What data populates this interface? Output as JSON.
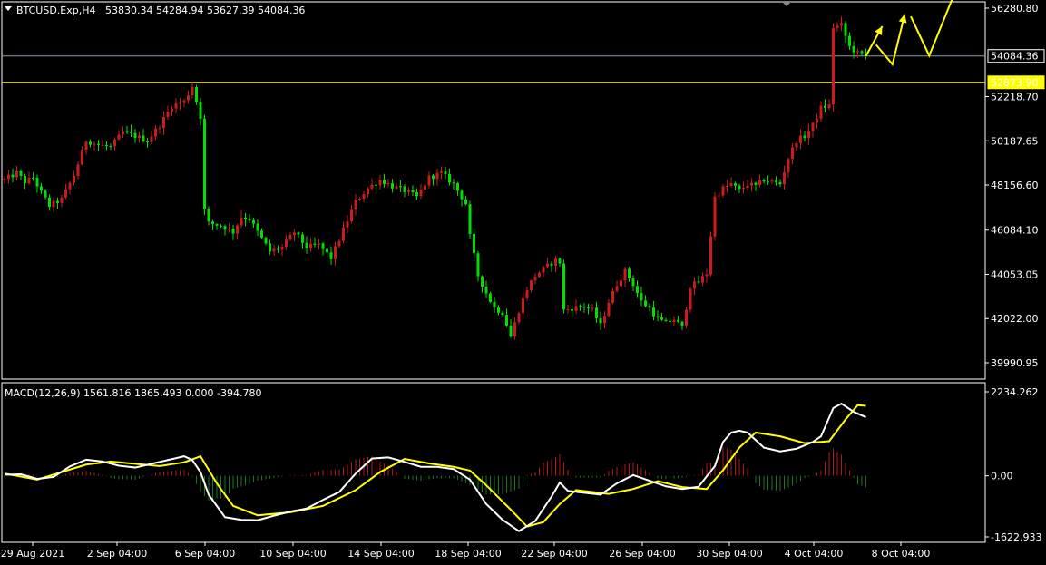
{
  "colors": {
    "background": "#000000",
    "frame": "#ffffff",
    "candle_up": "#cc1b1b",
    "candle_down": "#00e000",
    "level_line": "#ffff00",
    "price_line": "#8a9aa8",
    "macd_line": "#ffffff",
    "signal_line": "#ffff00",
    "hist_pos": "#b01818",
    "hist_neg": "#1a7a1a",
    "annotation": "#ffff00"
  },
  "header": {
    "menu_icon": "triangle-down-icon",
    "symbol": "BTCUSD.Exp,H4",
    "ohlc": "53830.34 54284.94 53627.39 54084.36"
  },
  "price_panel": {
    "y_ticks": [
      "56280.80",
      "52218.70",
      "50187.65",
      "48156.60",
      "46084.10",
      "44053.05",
      "42022.00",
      "39990.95"
    ],
    "current_price_label": "54084.36",
    "level_label": "52873.90"
  },
  "macd_panel": {
    "title": "MACD(12,26,9) 1561.816 1865.493 0.000 -394.780",
    "y_ticks": [
      "2234.262",
      "0.00",
      "-1622.933"
    ]
  },
  "time_axis": {
    "labels": [
      "29 Aug 2021",
      "2 Sep 04:00",
      "6 Sep 04:00",
      "10 Sep 04:00",
      "14 Sep 04:00",
      "18 Sep 04:00",
      "22 Sep 04:00",
      "26 Sep 04:00",
      "30 Sep 04:00",
      "4 Oct 04:00",
      "8 Oct 04:00"
    ]
  },
  "chart_data": {
    "type": "candlestick",
    "price_axis_range": [
      39990.95,
      56280.8
    ],
    "horizontal_levels": [
      52873.9,
      54084.36
    ],
    "close_path_anchors": [
      [
        0,
        48400
      ],
      [
        3,
        48700
      ],
      [
        5,
        48300
      ],
      [
        7,
        48500
      ],
      [
        9,
        47800
      ],
      [
        11,
        47200
      ],
      [
        14,
        47500
      ],
      [
        17,
        48600
      ],
      [
        20,
        50200
      ],
      [
        23,
        50000
      ],
      [
        26,
        49900
      ],
      [
        29,
        50600
      ],
      [
        32,
        50400
      ],
      [
        35,
        50200
      ],
      [
        38,
        50900
      ],
      [
        41,
        51800
      ],
      [
        44,
        52000
      ],
      [
        46,
        52700
      ],
      [
        47,
        52000
      ],
      [
        48,
        51300
      ],
      [
        49,
        47000
      ],
      [
        50,
        46400
      ],
      [
        53,
        46300
      ],
      [
        56,
        46000
      ],
      [
        58,
        46700
      ],
      [
        60,
        46600
      ],
      [
        62,
        46000
      ],
      [
        65,
        45100
      ],
      [
        68,
        45300
      ],
      [
        71,
        46000
      ],
      [
        74,
        45300
      ],
      [
        77,
        45400
      ],
      [
        80,
        44800
      ],
      [
        83,
        46100
      ],
      [
        86,
        47400
      ],
      [
        89,
        48000
      ],
      [
        92,
        48400
      ],
      [
        95,
        48100
      ],
      [
        98,
        47900
      ],
      [
        101,
        47600
      ],
      [
        104,
        48500
      ],
      [
        107,
        48700
      ],
      [
        110,
        48200
      ],
      [
        113,
        47300
      ],
      [
        114,
        45800
      ],
      [
        116,
        44000
      ],
      [
        118,
        43200
      ],
      [
        120,
        42500
      ],
      [
        122,
        42300
      ],
      [
        124,
        41200
      ],
      [
        126,
        42400
      ],
      [
        128,
        43400
      ],
      [
        130,
        44000
      ],
      [
        132,
        44300
      ],
      [
        135,
        44700
      ],
      [
        136,
        44600
      ],
      [
        137,
        42400
      ],
      [
        139,
        42500
      ],
      [
        142,
        42600
      ],
      [
        144,
        42400
      ],
      [
        146,
        41700
      ],
      [
        148,
        42800
      ],
      [
        150,
        43600
      ],
      [
        152,
        44200
      ],
      [
        154,
        43600
      ],
      [
        156,
        42800
      ],
      [
        158,
        42500
      ],
      [
        160,
        42000
      ],
      [
        162,
        41800
      ],
      [
        164,
        42000
      ],
      [
        166,
        41600
      ],
      [
        168,
        43500
      ],
      [
        170,
        43700
      ],
      [
        172,
        44100
      ],
      [
        174,
        47600
      ],
      [
        176,
        48000
      ],
      [
        178,
        48200
      ],
      [
        180,
        47900
      ],
      [
        182,
        48200
      ],
      [
        184,
        48100
      ],
      [
        186,
        48400
      ],
      [
        188,
        48300
      ],
      [
        190,
        48200
      ],
      [
        192,
        49400
      ],
      [
        194,
        50200
      ],
      [
        196,
        50400
      ],
      [
        198,
        50900
      ],
      [
        200,
        51700
      ],
      [
        202,
        51800
      ],
      [
        203,
        55400
      ],
      [
        205,
        55500
      ],
      [
        207,
        54500
      ],
      [
        209,
        54200
      ],
      [
        211,
        54100
      ]
    ],
    "macd_range": [
      -1622.933,
      2234.262
    ],
    "macd_anchors": [
      [
        0,
        30
      ],
      [
        4,
        40
      ],
      [
        8,
        -80
      ],
      [
        12,
        -30
      ],
      [
        16,
        250
      ],
      [
        20,
        430
      ],
      [
        24,
        380
      ],
      [
        28,
        270
      ],
      [
        32,
        220
      ],
      [
        36,
        320
      ],
      [
        40,
        420
      ],
      [
        44,
        520
      ],
      [
        46,
        420
      ],
      [
        48,
        100
      ],
      [
        50,
        -500
      ],
      [
        54,
        -1100
      ],
      [
        58,
        -1170
      ],
      [
        62,
        -1180
      ],
      [
        66,
        -1060
      ],
      [
        70,
        -950
      ],
      [
        74,
        -870
      ],
      [
        78,
        -640
      ],
      [
        82,
        -430
      ],
      [
        86,
        60
      ],
      [
        90,
        460
      ],
      [
        94,
        490
      ],
      [
        98,
        370
      ],
      [
        102,
        240
      ],
      [
        106,
        240
      ],
      [
        110,
        180
      ],
      [
        114,
        -100
      ],
      [
        118,
        -750
      ],
      [
        122,
        -1170
      ],
      [
        126,
        -1470
      ],
      [
        130,
        -1200
      ],
      [
        134,
        -550
      ],
      [
        136,
        -180
      ],
      [
        138,
        -400
      ],
      [
        142,
        -450
      ],
      [
        146,
        -500
      ],
      [
        150,
        -200
      ],
      [
        154,
        20
      ],
      [
        158,
        -130
      ],
      [
        162,
        -280
      ],
      [
        166,
        -350
      ],
      [
        170,
        -290
      ],
      [
        174,
        260
      ],
      [
        176,
        900
      ],
      [
        178,
        1150
      ],
      [
        180,
        1200
      ],
      [
        182,
        1150
      ],
      [
        186,
        750
      ],
      [
        190,
        650
      ],
      [
        194,
        720
      ],
      [
        198,
        900
      ],
      [
        200,
        1050
      ],
      [
        203,
        1800
      ],
      [
        205,
        1920
      ],
      [
        208,
        1700
      ],
      [
        211,
        1560
      ]
    ],
    "signal_anchors": [
      [
        0,
        60
      ],
      [
        8,
        -100
      ],
      [
        14,
        100
      ],
      [
        20,
        300
      ],
      [
        26,
        380
      ],
      [
        32,
        320
      ],
      [
        38,
        260
      ],
      [
        44,
        360
      ],
      [
        48,
        520
      ],
      [
        52,
        -200
      ],
      [
        56,
        -800
      ],
      [
        62,
        -1050
      ],
      [
        70,
        -970
      ],
      [
        78,
        -800
      ],
      [
        86,
        -380
      ],
      [
        92,
        100
      ],
      [
        98,
        450
      ],
      [
        104,
        330
      ],
      [
        110,
        240
      ],
      [
        114,
        140
      ],
      [
        118,
        -250
      ],
      [
        124,
        -900
      ],
      [
        128,
        -1350
      ],
      [
        132,
        -1230
      ],
      [
        136,
        -750
      ],
      [
        140,
        -380
      ],
      [
        148,
        -480
      ],
      [
        154,
        -350
      ],
      [
        160,
        -140
      ],
      [
        166,
        -300
      ],
      [
        172,
        -350
      ],
      [
        176,
        150
      ],
      [
        180,
        750
      ],
      [
        184,
        1150
      ],
      [
        190,
        1050
      ],
      [
        196,
        870
      ],
      [
        202,
        920
      ],
      [
        206,
        1500
      ],
      [
        209,
        1880
      ],
      [
        211,
        1860
      ]
    ],
    "annotation_arrows": [
      [
        [
          211,
          54084.36
        ],
        [
          215,
          55450
        ]
      ],
      [
        [
          213.5,
          54600
        ],
        [
          217.5,
          53700
        ],
        [
          220.5,
          56000
        ]
      ],
      [
        [
          222,
          55900
        ],
        [
          226.5,
          54100
        ],
        [
          233,
          57100
        ]
      ]
    ]
  }
}
